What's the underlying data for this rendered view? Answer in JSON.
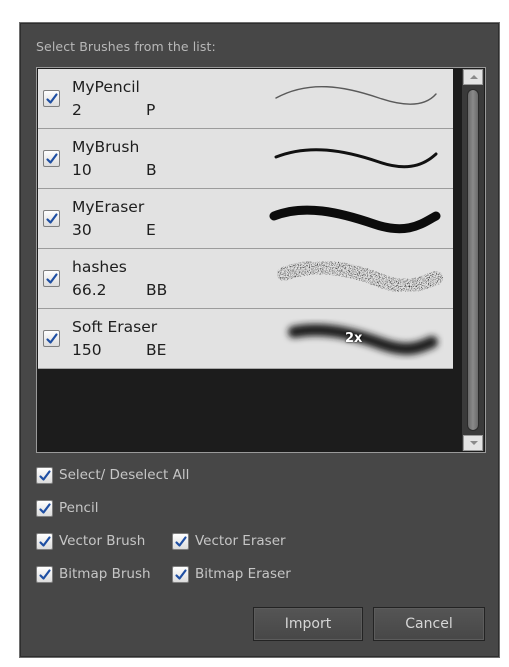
{
  "dialog": {
    "prompt": "Select Brushes from the list:"
  },
  "brushes": [
    {
      "name": "MyPencil",
      "size": "2",
      "shortcut": "P",
      "checked": true,
      "stroke": "pencil-stroke"
    },
    {
      "name": "MyBrush",
      "size": "10",
      "shortcut": "B",
      "checked": true,
      "stroke": "brush-stroke"
    },
    {
      "name": "MyEraser",
      "size": "30",
      "shortcut": "E",
      "checked": true,
      "stroke": "eraser-stroke"
    },
    {
      "name": "hashes",
      "size": "66.2",
      "shortcut": "BB",
      "checked": true,
      "stroke": "texture-stroke"
    },
    {
      "name": "Soft Eraser",
      "size": "150",
      "shortcut": "BE",
      "checked": true,
      "stroke": "soft-stroke",
      "badge": "2x"
    }
  ],
  "options": {
    "select_all": "Select/ Deselect All",
    "pencil": "Pencil",
    "vector_brush": "Vector Brush",
    "vector_eraser": "Vector Eraser",
    "bitmap_brush": "Bitmap Brush",
    "bitmap_eraser": "Bitmap Eraser"
  },
  "buttons": {
    "import": "Import",
    "cancel": "Cancel"
  },
  "icons": {
    "check": "check-icon",
    "scroll_up": "arrow-up-icon",
    "scroll_down": "arrow-down-icon"
  },
  "colors": {
    "dialog_bg": "#474747",
    "row_bg": "#e2e2e2",
    "list_bg": "#1c1c1c",
    "check": "#1f4fa3"
  }
}
